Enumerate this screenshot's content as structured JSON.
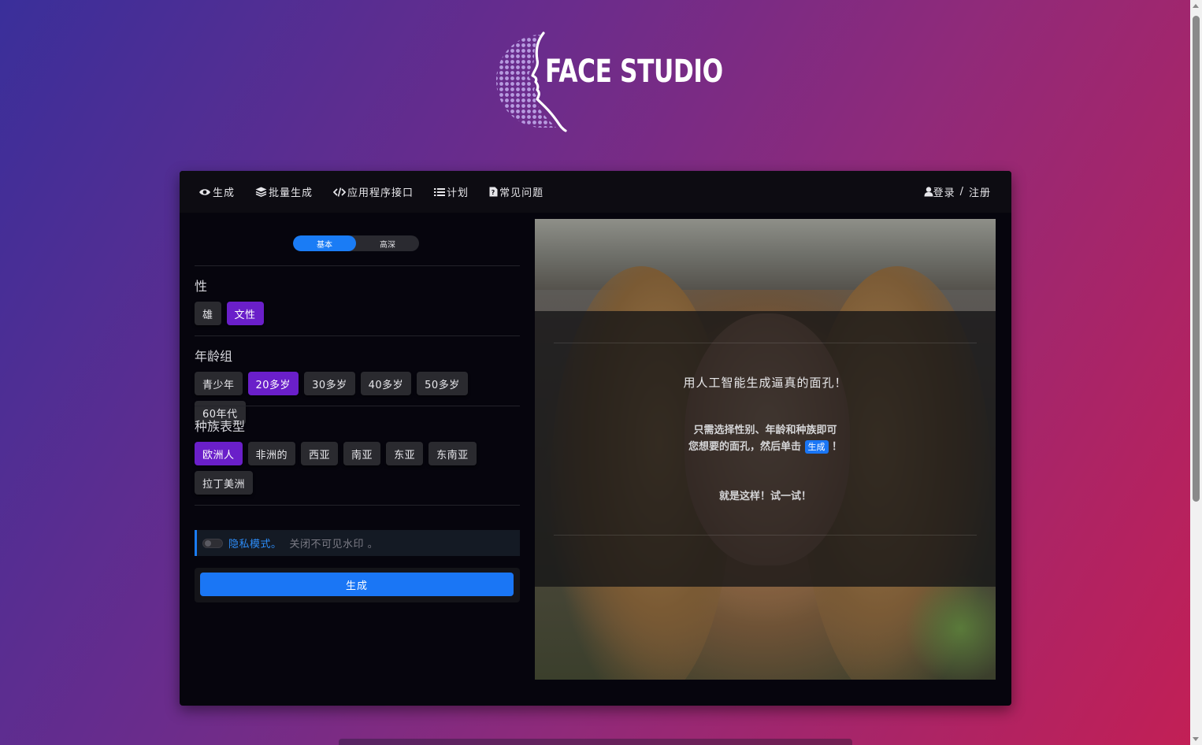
{
  "logo": {
    "text": "FACE STUDIO"
  },
  "nav": {
    "items": [
      {
        "label": "生成",
        "icon": "eye-icon"
      },
      {
        "label": "批量生成",
        "icon": "layers-icon"
      },
      {
        "label": "应用程序接口",
        "icon": "code-icon"
      },
      {
        "label": "计划",
        "icon": "list-icon"
      },
      {
        "label": "常见问题",
        "icon": "question-file-icon"
      }
    ],
    "login": "登录",
    "separator": "/",
    "register": "注册"
  },
  "mode_toggle": {
    "basic": "基本",
    "advanced": "高深",
    "selected": "基本"
  },
  "gender": {
    "title": "性",
    "options": [
      "雄",
      "文性"
    ],
    "selected": "文性"
  },
  "age": {
    "title": "年龄组",
    "options": [
      "青少年",
      "20多岁",
      "30多岁",
      "40多岁",
      "50多岁",
      "60年代"
    ],
    "selected": "20多岁"
  },
  "ethnicity": {
    "title": "种族表型",
    "options": [
      "欧洲人",
      "非洲的",
      "西亚",
      "南亚",
      "东亚",
      "东南亚",
      "拉丁美洲"
    ],
    "selected": "欧洲人"
  },
  "privacy": {
    "label": "隐私模式。",
    "description": "关闭不可见水印 。",
    "enabled": false
  },
  "generate_button": "生成",
  "preview": {
    "title": "用人工智能生成逼真的面孔！",
    "desc_line1": "只需选择性别、年龄和种族即可",
    "desc_line2_prefix": "您想要的面孔，然后单击",
    "desc_badge": "生成",
    "desc_line2_suffix": "！",
    "closing": "就是这样！试一试！"
  },
  "colors": {
    "accent": "#1a76f5",
    "selected_chip": "#6a1fc9",
    "card_bg": "#06050d"
  }
}
